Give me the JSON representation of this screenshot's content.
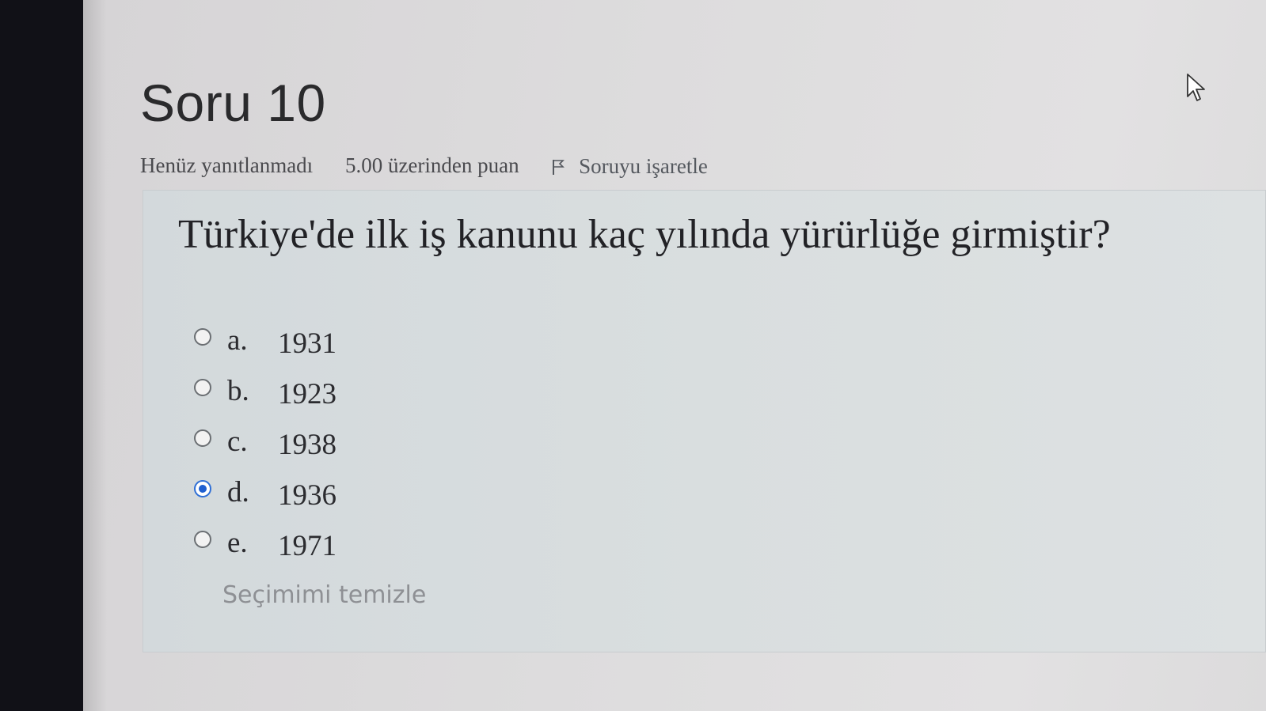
{
  "question": {
    "title": "Soru 10",
    "status": "Henüz yanıtlanmadı",
    "points": "5.00 üzerinden puan",
    "flag_label": "Soruyu işaretle",
    "flag_icon": "flag-icon",
    "text": "Türkiye'de ilk iş kanunu kaç yılında yürürlüğe girmiştir?"
  },
  "answers": [
    {
      "letter": "a.",
      "value": "1931",
      "selected": false
    },
    {
      "letter": "b.",
      "value": "1923",
      "selected": false
    },
    {
      "letter": "c.",
      "value": "1938",
      "selected": false
    },
    {
      "letter": "d.",
      "value": "1936",
      "selected": true
    },
    {
      "letter": "e.",
      "value": "1971",
      "selected": false
    }
  ],
  "clear_choice_label": "Seçimimi temizle",
  "colors": {
    "radio_selected": "#1f5fd0",
    "page_background": "#dddcdd",
    "content_box": "#d9dedf"
  }
}
